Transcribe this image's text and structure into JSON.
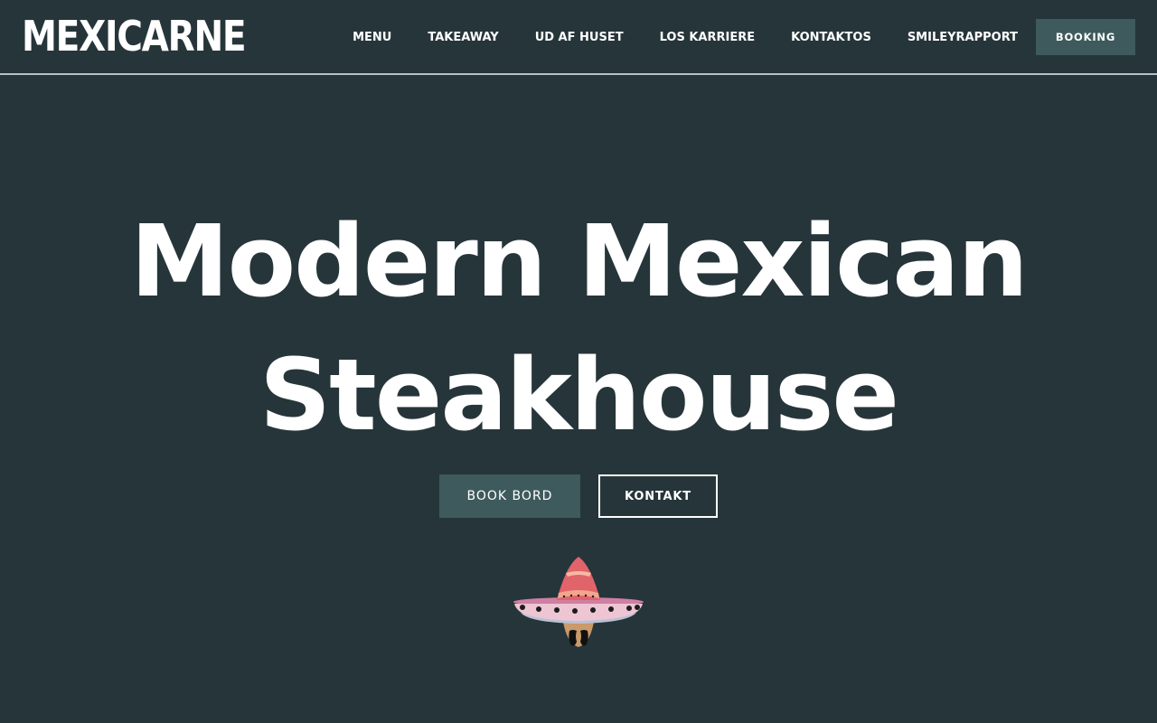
{
  "header": {
    "logo_text": "MEXICARNE",
    "nav": [
      {
        "label": "MENU"
      },
      {
        "label": "TAKEAWAY"
      },
      {
        "label": "UD AF HUSET"
      },
      {
        "label": "LOS KARRIERE"
      },
      {
        "label": "KONTAKTOS"
      },
      {
        "label": "SMILEYRAPPORT"
      }
    ],
    "booking_label": "BOOKING"
  },
  "hero": {
    "title_line1": "Modern Mexican",
    "title_line2": "Steakhouse",
    "book_button": "BOOK BORD",
    "contact_button": "KONTAKT",
    "mascot_icon": "sombrero-mascot-icon"
  },
  "colors": {
    "background": "#26353a",
    "accent_button": "#3e5a5d",
    "header_border": "#b7c3c1",
    "text": "#ffffff"
  }
}
